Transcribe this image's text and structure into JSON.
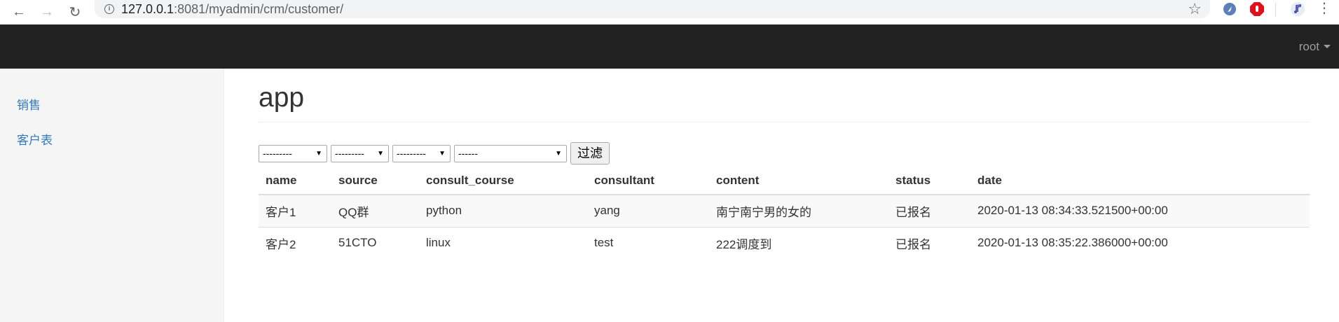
{
  "browser": {
    "url_host": "127.0.0.1",
    "url_rest": ":8081/myadmin/crm/customer/"
  },
  "navbar": {
    "user": "root"
  },
  "sidebar": {
    "items": [
      {
        "label": "销售"
      },
      {
        "label": "客户表"
      }
    ]
  },
  "main": {
    "title": "app",
    "filters": [
      {
        "selected": "---------"
      },
      {
        "selected": "---------"
      },
      {
        "selected": "---------"
      },
      {
        "selected": "------"
      }
    ],
    "filter_button": "过滤",
    "table": {
      "columns": [
        "name",
        "source",
        "consult_course",
        "consultant",
        "content",
        "status",
        "date"
      ],
      "rows": [
        [
          "客户1",
          "QQ群",
          "python",
          "yang",
          "南宁南宁男的女的",
          "已报名",
          "2020-01-13 08:34:33.521500+00:00"
        ],
        [
          "客户2",
          "51CTO",
          "linux",
          "test",
          "222调度到",
          "已报名",
          "2020-01-13 08:35:22.386000+00:00"
        ]
      ]
    }
  },
  "colors": {
    "navbar": "#222222",
    "link": "#337ab7",
    "sidebar_bg": "#f5f5f5"
  }
}
